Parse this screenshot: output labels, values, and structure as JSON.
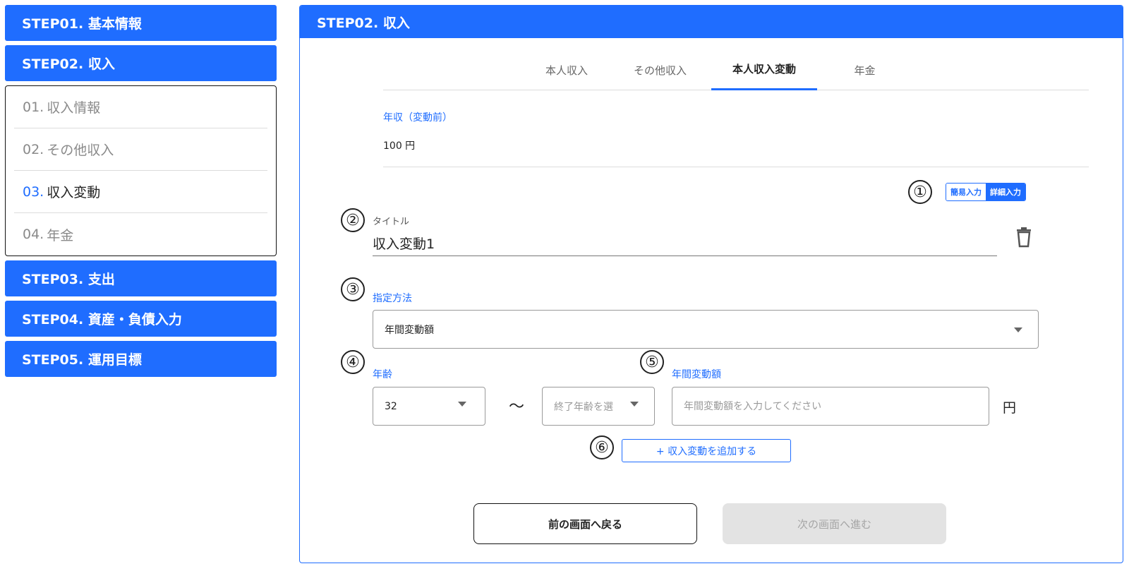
{
  "sidebar": {
    "steps_top": [
      {
        "label": "STEP01. 基本情報"
      },
      {
        "label": "STEP02. 収入"
      }
    ],
    "substeps": [
      {
        "num": "01.",
        "label": "収入情報"
      },
      {
        "num": "02.",
        "label": "その他収入"
      },
      {
        "num": "03.",
        "label": "収入変動"
      },
      {
        "num": "04.",
        "label": "年金"
      }
    ],
    "steps_bottom": [
      {
        "label": "STEP03. 支出"
      },
      {
        "label": "STEP04. 資産・負債入力"
      },
      {
        "label": "STEP05. 運用目標"
      }
    ]
  },
  "panel": {
    "header": "STEP02. 収入",
    "tabs": [
      {
        "label": "本人収入"
      },
      {
        "label": "その他収入"
      },
      {
        "label": "本人収入変動"
      },
      {
        "label": "年金"
      }
    ],
    "active_tab": "本人収入変動",
    "income": {
      "label": "年収（変動前）",
      "value": "100  円"
    },
    "markers": [
      "①",
      "②",
      "③",
      "④",
      "⑤",
      "⑥"
    ],
    "input_mode": {
      "simple": "簡易入力",
      "detail": "詳細入力"
    },
    "title_field": {
      "label": "タイトル",
      "value": "収入変動1"
    },
    "method": {
      "label": "指定方法",
      "value": "年間変動額"
    },
    "age": {
      "label": "年齢",
      "start_value": "32",
      "tilde": "～",
      "end_placeholder": "終了年齢を選"
    },
    "amount": {
      "label": "年間変動額",
      "placeholder": "年間変動額を入力してください",
      "unit": "円"
    },
    "add_button": "+ 収入変動を追加する",
    "back_button": "前の画面へ戻る",
    "next_button": "次の画面へ進む"
  },
  "colors": {
    "accent": "#1f6dff",
    "disabled_bg": "#e3e3e3",
    "disabled_text": "#a5a5a5"
  }
}
